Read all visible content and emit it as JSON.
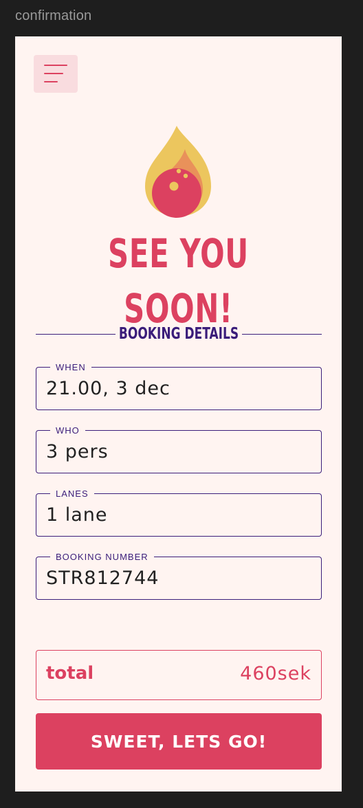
{
  "frame": {
    "label": "confirmation"
  },
  "headline": "SEE YOU SOON!",
  "section_title": "BOOKING DETAILS",
  "fields": [
    {
      "label": "WHEN",
      "value": "21.00, 3 dec"
    },
    {
      "label": "WHO",
      "value": "3 pers"
    },
    {
      "label": "LANES",
      "value": "1 lane"
    },
    {
      "label": "BOOKING NUMBER",
      "value": "STR812744"
    }
  ],
  "total": {
    "label": "total",
    "value": "460sek"
  },
  "cta": {
    "label": "SWEET, LETS GO!"
  },
  "colors": {
    "accent": "#dc4160",
    "secondary": "#3a1d7a",
    "background": "#fff4f1",
    "flame_outer": "#ecc65e",
    "flame_inner": "#e9915a"
  },
  "icons": {
    "menu": "hamburger-menu-icon",
    "logo": "flaming-bowling-ball-icon"
  }
}
